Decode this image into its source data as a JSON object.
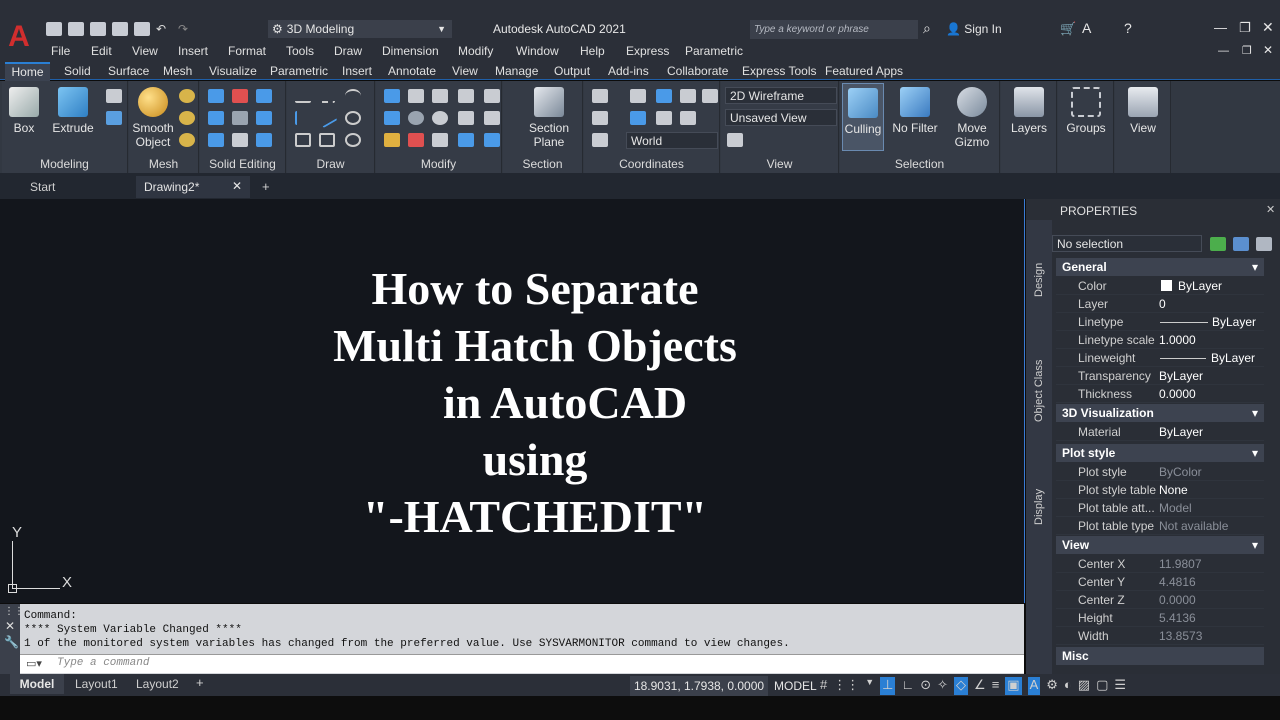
{
  "app": {
    "title": "Autodesk AutoCAD 2021",
    "logo": "A",
    "workspace": "3D Modeling",
    "search_placeholder": "Type a keyword or phrase",
    "sign_in": "Sign In"
  },
  "menus": [
    "File",
    "Edit",
    "View",
    "Insert",
    "Format",
    "Tools",
    "Draw",
    "Dimension",
    "Modify",
    "Window",
    "Help",
    "Express",
    "Parametric"
  ],
  "ribbon_tabs": [
    "Home",
    "Solid",
    "Surface",
    "Mesh",
    "Visualize",
    "Parametric",
    "Insert",
    "Annotate",
    "View",
    "Manage",
    "Output",
    "Add-ins",
    "Collaborate",
    "Express Tools",
    "Featured Apps"
  ],
  "ribbon": {
    "modeling": {
      "box": "Box",
      "extrude": "Extrude",
      "title": "Modeling"
    },
    "mesh": {
      "smooth": "Smooth\nObject",
      "title": "Mesh"
    },
    "solid_editing": {
      "title": "Solid Editing"
    },
    "draw": {
      "title": "Draw"
    },
    "modify": {
      "title": "Modify"
    },
    "section": {
      "plane": "Section\nPlane",
      "title": "Section"
    },
    "coordinates": {
      "world": "World",
      "title": "Coordinates"
    },
    "view": {
      "visual_style": "2D Wireframe",
      "named_view": "Unsaved View",
      "title": "View"
    },
    "selection": {
      "culling": "Culling",
      "no_filter": "No Filter",
      "move_gizmo": "Move\nGizmo",
      "title": "Selection"
    },
    "layers": "Layers",
    "groups": "Groups",
    "view_big": "View"
  },
  "file_tabs": {
    "start": "Start",
    "drawing": "Drawing2*"
  },
  "headline": [
    "How to Separate",
    "Multi Hatch Objects",
    "in AutoCAD",
    "using",
    "\"-HATCHEDIT\""
  ],
  "ucs": {
    "y": "Y",
    "x": "X"
  },
  "command": {
    "lines": [
      "Command:",
      "**** System Variable Changed ****",
      "1 of the monitored system variables has changed from the preferred value. Use SYSVARMONITOR command to view changes."
    ],
    "placeholder": "Type a command"
  },
  "layout_tabs": [
    "Model",
    "Layout1",
    "Layout2"
  ],
  "status": {
    "coords": "18.9031, 1.7938, 0.0000",
    "space": "MODEL"
  },
  "properties": {
    "title": "PROPERTIES",
    "selection": "No selection",
    "side_tabs": [
      "Design",
      "Object Class",
      "Display"
    ],
    "sections": [
      {
        "name": "General",
        "rows": [
          [
            "Color",
            "ByLayer"
          ],
          [
            "Layer",
            "0"
          ],
          [
            "Linetype",
            "ByLayer"
          ],
          [
            "Linetype scale",
            "1.0000"
          ],
          [
            "Lineweight",
            "ByLayer"
          ],
          [
            "Transparency",
            "ByLayer"
          ],
          [
            "Thickness",
            "0.0000"
          ]
        ]
      },
      {
        "name": "3D Visualization",
        "rows": [
          [
            "Material",
            "ByLayer"
          ]
        ]
      },
      {
        "name": "Plot style",
        "rows": [
          [
            "Plot style",
            "ByColor"
          ],
          [
            "Plot style table",
            "None"
          ],
          [
            "Plot table att...",
            "Model"
          ],
          [
            "Plot table type",
            "Not available"
          ]
        ]
      },
      {
        "name": "View",
        "rows": [
          [
            "Center X",
            "11.9807"
          ],
          [
            "Center Y",
            "4.4816"
          ],
          [
            "Center Z",
            "0.0000"
          ],
          [
            "Height",
            "5.4136"
          ],
          [
            "Width",
            "13.8573"
          ]
        ]
      },
      {
        "name": "Misc",
        "rows": []
      }
    ]
  }
}
